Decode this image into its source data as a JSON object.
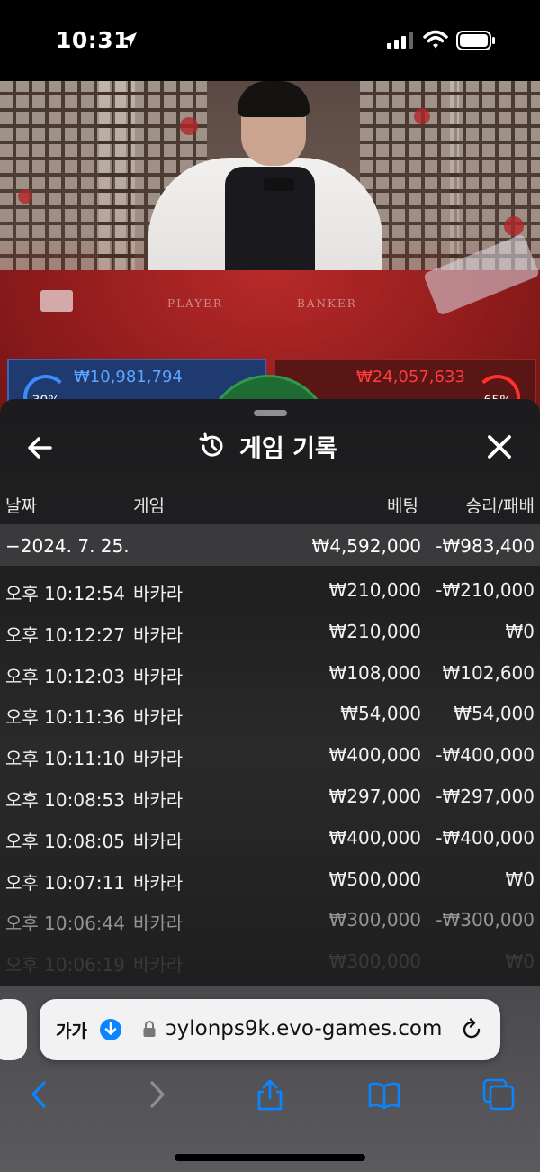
{
  "status_bar": {
    "time": "10:31"
  },
  "sheet": {
    "title": "게임 기록",
    "columns": {
      "date": "날짜",
      "game": "게임",
      "bet": "베팅",
      "win_loss": "승리/패배"
    },
    "summary": {
      "date": "−2024. 7. 25.",
      "bet": "₩4,592,000",
      "win_loss": "-₩983,400"
    },
    "rows": [
      {
        "time": "오후 10:12:54",
        "game": "바카라",
        "bet": "₩210,000",
        "win_loss": "-₩210,000"
      },
      {
        "time": "오후 10:12:27",
        "game": "바카라",
        "bet": "₩210,000",
        "win_loss": "₩0"
      },
      {
        "time": "오후 10:12:03",
        "game": "바카라",
        "bet": "₩108,000",
        "win_loss": "₩102,600"
      },
      {
        "time": "오후 10:11:36",
        "game": "바카라",
        "bet": "₩54,000",
        "win_loss": "₩54,000"
      },
      {
        "time": "오후 10:11:10",
        "game": "바카라",
        "bet": "₩400,000",
        "win_loss": "-₩400,000"
      },
      {
        "time": "오후 10:08:53",
        "game": "바카라",
        "bet": "₩297,000",
        "win_loss": "-₩297,000"
      },
      {
        "time": "오후 10:08:05",
        "game": "바카라",
        "bet": "₩400,000",
        "win_loss": "-₩400,000"
      },
      {
        "time": "오후 10:07:11",
        "game": "바카라",
        "bet": "₩500,000",
        "win_loss": "₩0"
      },
      {
        "time": "오후 10:06:44",
        "game": "바카라",
        "bet": "₩300,000",
        "win_loss": "-₩300,000"
      },
      {
        "time": "오후 10:06:19",
        "game": "바카라",
        "bet": "₩300,000",
        "win_loss": "₩0"
      }
    ]
  },
  "game_view": {
    "player_label": "PLAYER",
    "banker_label": "BANKER",
    "player_bet": "₩10,981,794",
    "banker_bet": "₩24,057,633",
    "player_pct": "30%",
    "banker_pct": "65%"
  },
  "browser": {
    "text_size_label": "가가",
    "url": "ɔylonps9k.evo-games.com"
  },
  "colors": {
    "accent_blue": "#0a84ff",
    "player_blue": "#5da6ff",
    "banker_red": "#ff3b3b"
  }
}
